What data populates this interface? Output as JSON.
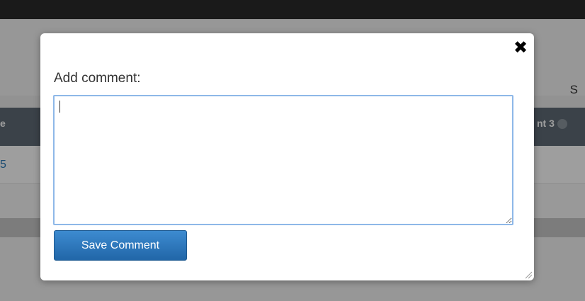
{
  "background": {
    "header_right_text": "S",
    "table_header_left_text": "e",
    "table_header_right_text": "nt 3",
    "row_1_link_text": "5"
  },
  "modal": {
    "close_glyph": "✖",
    "title": "Add comment:",
    "comment_value": "",
    "save_button_label": "Save Comment"
  }
}
